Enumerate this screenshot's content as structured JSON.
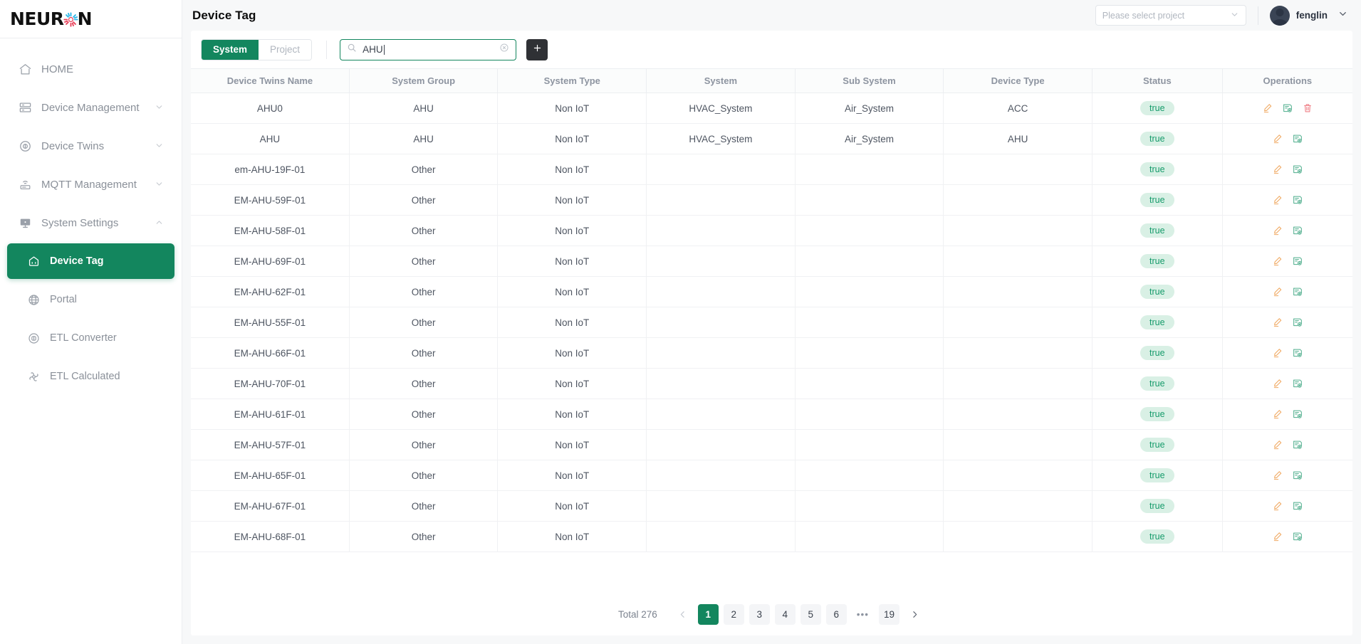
{
  "brand": {
    "name": "NEURON",
    "logo_icon": "neuron-burst-logo"
  },
  "sidebar": {
    "items": [
      {
        "label": "HOME",
        "icon": "home-icon",
        "has_caret": false,
        "active": false,
        "sub": false
      },
      {
        "label": "Device Management",
        "icon": "server-icon",
        "has_caret": true,
        "active": false,
        "sub": false
      },
      {
        "label": "Device Twins",
        "icon": "twins-icon",
        "has_caret": true,
        "active": false,
        "sub": false
      },
      {
        "label": "MQTT Management",
        "icon": "broadcast-icon",
        "has_caret": true,
        "active": false,
        "sub": false
      },
      {
        "label": "System Settings",
        "icon": "monitor-icon",
        "has_caret": true,
        "active": false,
        "sub": false
      },
      {
        "label": "Device Tag",
        "icon": "tag-icon",
        "has_caret": false,
        "active": true,
        "sub": true
      },
      {
        "label": "Portal",
        "icon": "globe-icon",
        "has_caret": false,
        "active": false,
        "sub": true
      },
      {
        "label": "ETL Converter",
        "icon": "converter-icon",
        "has_caret": false,
        "active": false,
        "sub": true
      },
      {
        "label": "ETL Calculated",
        "icon": "calculated-icon",
        "has_caret": false,
        "active": false,
        "sub": true
      }
    ]
  },
  "header": {
    "title": "Device Tag",
    "project_select": {
      "placeholder": "Please select project",
      "caret_icon": "chevron-down-icon"
    },
    "user": {
      "name": "fenglin",
      "avatar_icon": "user-avatar",
      "caret_icon": "chevron-down-icon"
    }
  },
  "toolbar": {
    "segments": [
      {
        "label": "System",
        "active": true
      },
      {
        "label": "Project",
        "active": false
      }
    ],
    "search": {
      "value": "AHU",
      "placeholder": "",
      "icon": "search-icon",
      "clear_icon": "clear-circle-icon"
    },
    "add_button": {
      "label": "+",
      "icon": "plus-icon"
    }
  },
  "table": {
    "columns": [
      "Device Twins Name",
      "System Group",
      "System Type",
      "System",
      "Sub System",
      "Device Type",
      "Status",
      "Operations"
    ],
    "rows": [
      {
        "name": "AHU0",
        "group": "AHU",
        "type": "Non IoT",
        "system": "HVAC_System",
        "sub_system": "Air_System",
        "device_type": "ACC",
        "status": "true",
        "ops": [
          "edit-icon",
          "view-icon",
          "delete-icon"
        ]
      },
      {
        "name": "AHU",
        "group": "AHU",
        "type": "Non IoT",
        "system": "HVAC_System",
        "sub_system": "Air_System",
        "device_type": "AHU",
        "status": "true",
        "ops": [
          "edit-icon",
          "view-icon"
        ]
      },
      {
        "name": "em-AHU-19F-01",
        "group": "Other",
        "type": "Non IoT",
        "system": "",
        "sub_system": "",
        "device_type": "",
        "status": "true",
        "ops": [
          "edit-icon",
          "view-icon"
        ]
      },
      {
        "name": "EM-AHU-59F-01",
        "group": "Other",
        "type": "Non IoT",
        "system": "",
        "sub_system": "",
        "device_type": "",
        "status": "true",
        "ops": [
          "edit-icon",
          "view-icon"
        ]
      },
      {
        "name": "EM-AHU-58F-01",
        "group": "Other",
        "type": "Non IoT",
        "system": "",
        "sub_system": "",
        "device_type": "",
        "status": "true",
        "ops": [
          "edit-icon",
          "view-icon"
        ]
      },
      {
        "name": "EM-AHU-69F-01",
        "group": "Other",
        "type": "Non IoT",
        "system": "",
        "sub_system": "",
        "device_type": "",
        "status": "true",
        "ops": [
          "edit-icon",
          "view-icon"
        ]
      },
      {
        "name": "EM-AHU-62F-01",
        "group": "Other",
        "type": "Non IoT",
        "system": "",
        "sub_system": "",
        "device_type": "",
        "status": "true",
        "ops": [
          "edit-icon",
          "view-icon"
        ]
      },
      {
        "name": "EM-AHU-55F-01",
        "group": "Other",
        "type": "Non IoT",
        "system": "",
        "sub_system": "",
        "device_type": "",
        "status": "true",
        "ops": [
          "edit-icon",
          "view-icon"
        ]
      },
      {
        "name": "EM-AHU-66F-01",
        "group": "Other",
        "type": "Non IoT",
        "system": "",
        "sub_system": "",
        "device_type": "",
        "status": "true",
        "ops": [
          "edit-icon",
          "view-icon"
        ]
      },
      {
        "name": "EM-AHU-70F-01",
        "group": "Other",
        "type": "Non IoT",
        "system": "",
        "sub_system": "",
        "device_type": "",
        "status": "true",
        "ops": [
          "edit-icon",
          "view-icon"
        ]
      },
      {
        "name": "EM-AHU-61F-01",
        "group": "Other",
        "type": "Non IoT",
        "system": "",
        "sub_system": "",
        "device_type": "",
        "status": "true",
        "ops": [
          "edit-icon",
          "view-icon"
        ]
      },
      {
        "name": "EM-AHU-57F-01",
        "group": "Other",
        "type": "Non IoT",
        "system": "",
        "sub_system": "",
        "device_type": "",
        "status": "true",
        "ops": [
          "edit-icon",
          "view-icon"
        ]
      },
      {
        "name": "EM-AHU-65F-01",
        "group": "Other",
        "type": "Non IoT",
        "system": "",
        "sub_system": "",
        "device_type": "",
        "status": "true",
        "ops": [
          "edit-icon",
          "view-icon"
        ]
      },
      {
        "name": "EM-AHU-67F-01",
        "group": "Other",
        "type": "Non IoT",
        "system": "",
        "sub_system": "",
        "device_type": "",
        "status": "true",
        "ops": [
          "edit-icon",
          "view-icon"
        ]
      },
      {
        "name": "EM-AHU-68F-01",
        "group": "Other",
        "type": "Non IoT",
        "system": "",
        "sub_system": "",
        "device_type": "",
        "status": "true",
        "ops": [
          "edit-icon",
          "view-icon"
        ]
      }
    ]
  },
  "pagination": {
    "total_label": "Total 276",
    "prev_icon": "chevron-left-icon",
    "next_icon": "chevron-right-icon",
    "pages": [
      "1",
      "2",
      "3",
      "4",
      "5",
      "6",
      "•••",
      "19"
    ],
    "active_page": "1"
  },
  "colors": {
    "brand_green": "#13865e",
    "badge_bg": "#d9f0e5",
    "badge_text": "#169b6b",
    "edit_icon": "#f0a860",
    "view_icon": "#4bac8a",
    "delete_icon": "#ef7f86",
    "add_button_bg": "#2f3135"
  }
}
